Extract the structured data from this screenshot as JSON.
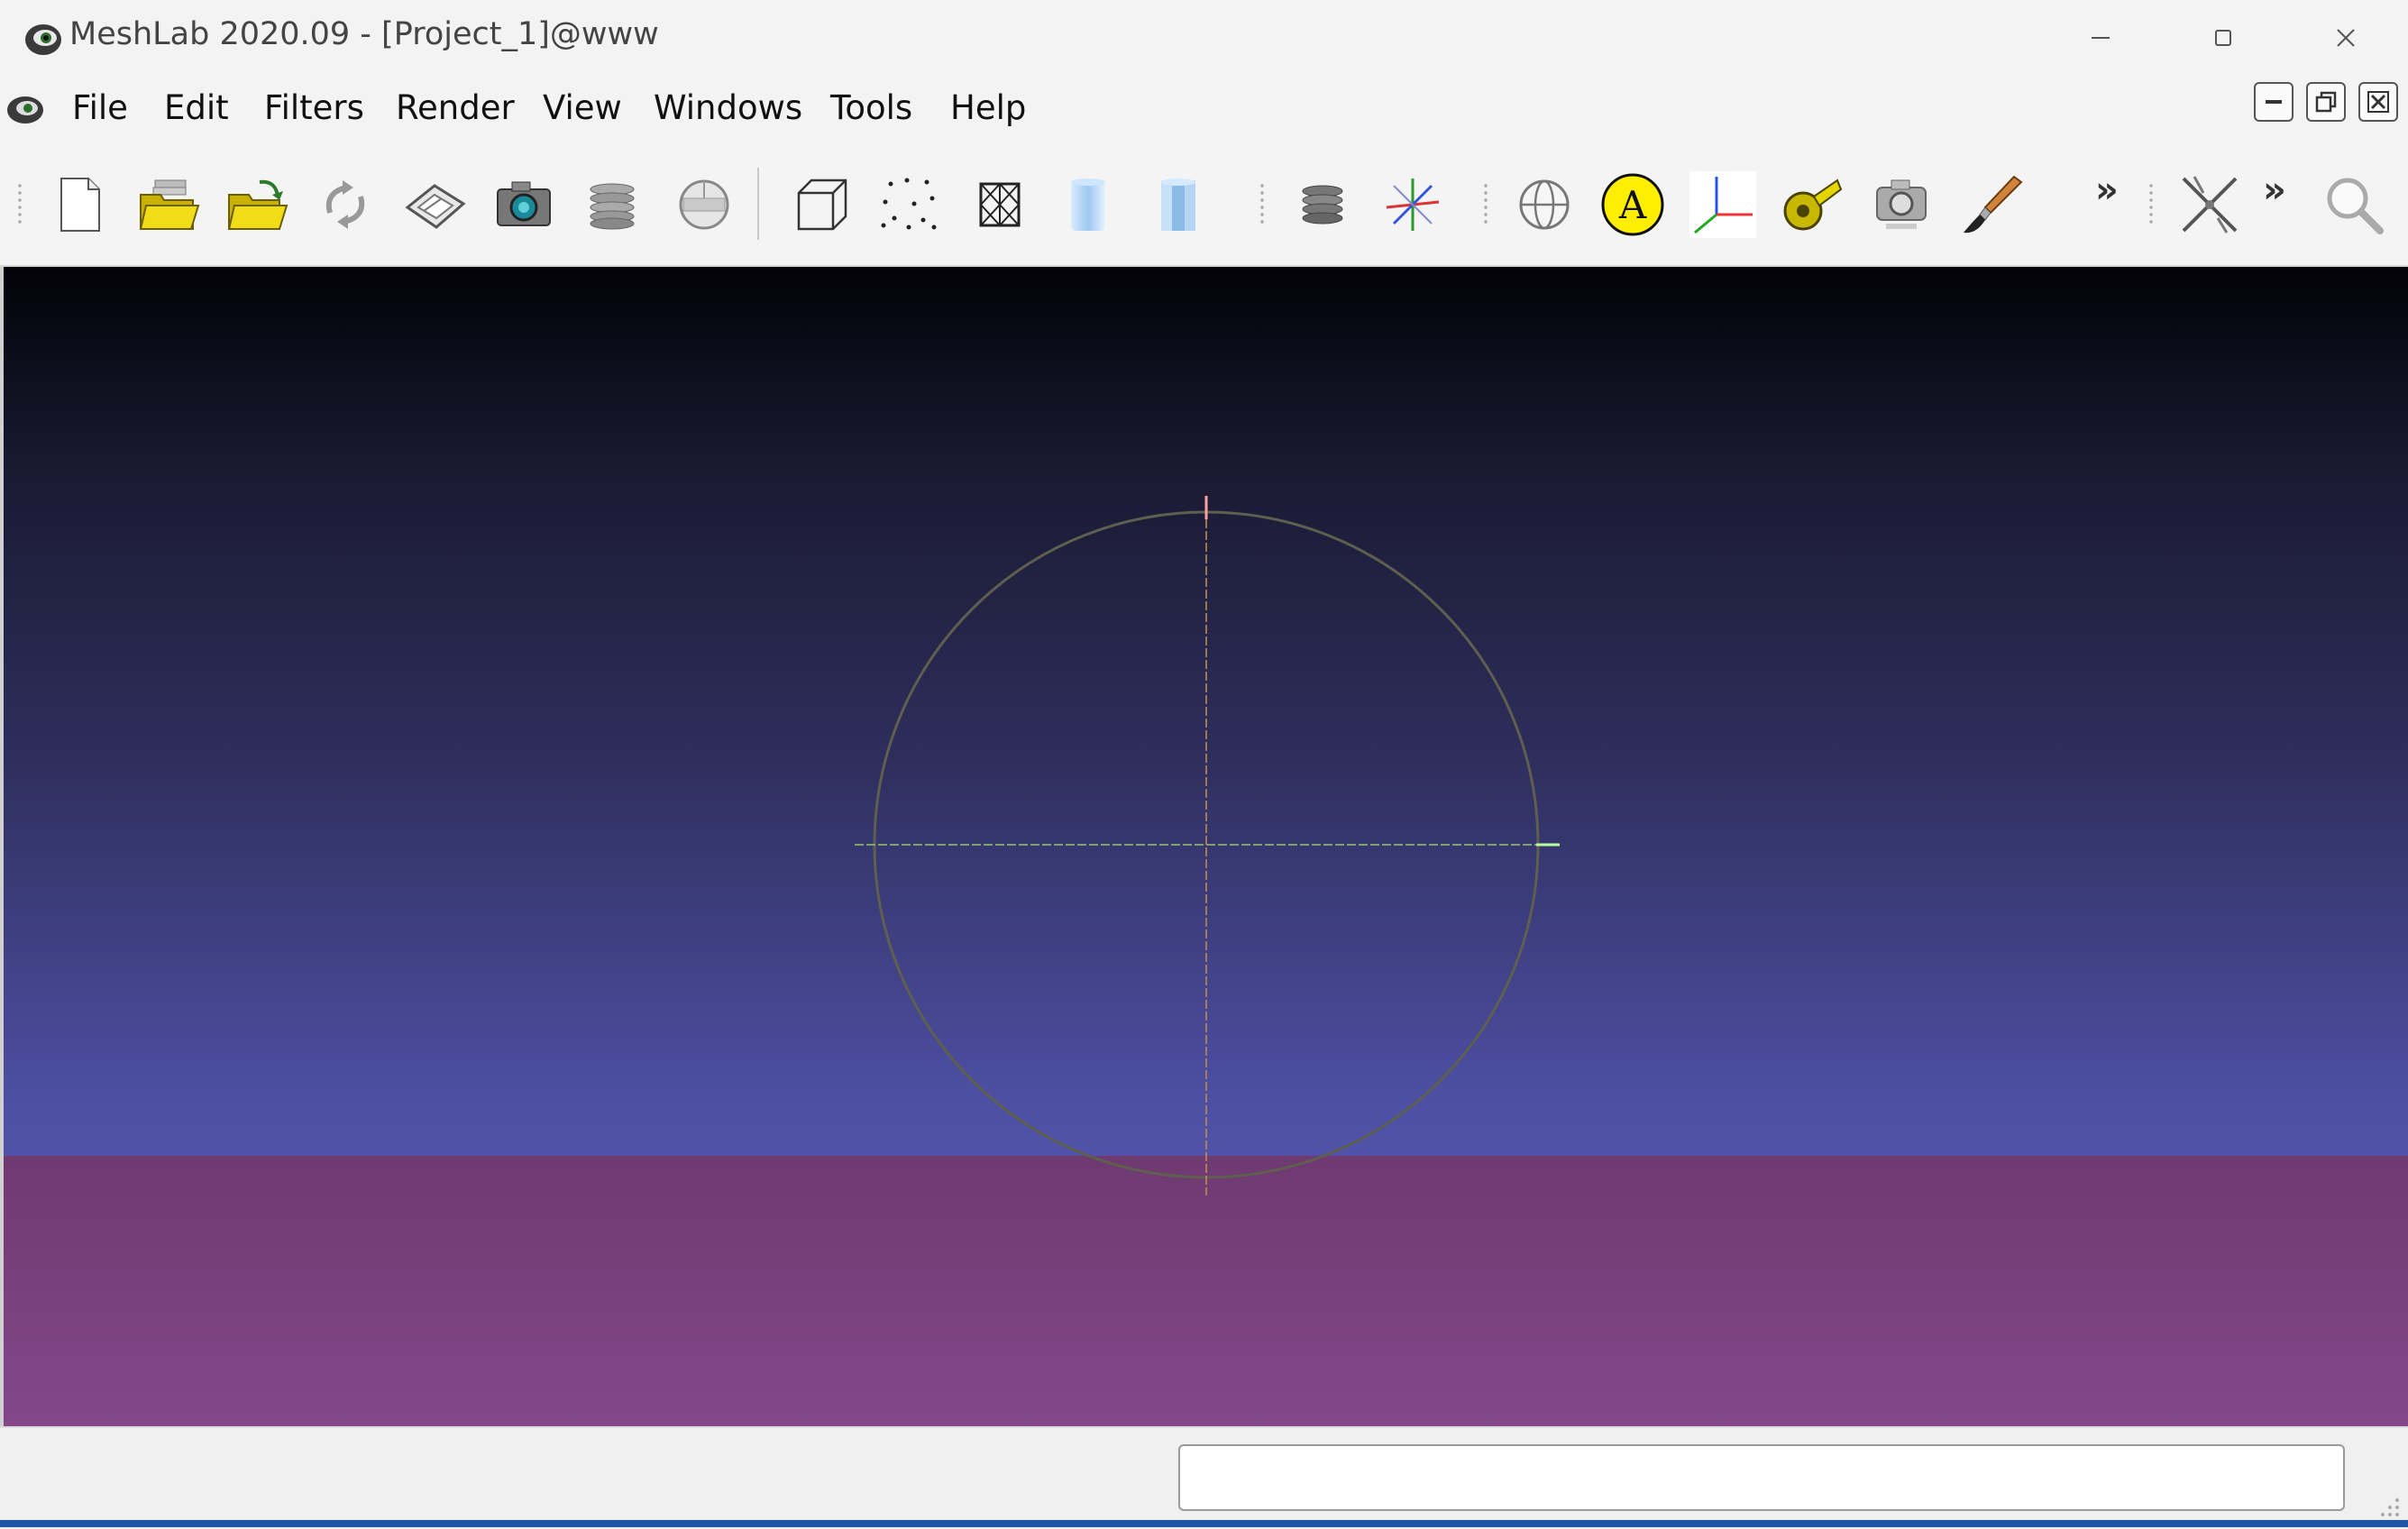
{
  "window": {
    "title": "MeshLab 2020.09 - [Project_1]@www"
  },
  "menubar": {
    "items": [
      {
        "label": "File"
      },
      {
        "label": "Edit"
      },
      {
        "label": "Filters"
      },
      {
        "label": "Render"
      },
      {
        "label": "View"
      },
      {
        "label": "Windows"
      },
      {
        "label": "Tools"
      },
      {
        "label": "Help"
      }
    ]
  },
  "toolbar": {
    "groups": [
      {
        "name": "file",
        "icons": [
          "new-project-icon",
          "open-project-icon",
          "import-mesh-icon",
          "reload-icon",
          "export-mesh-icon",
          "snapshot-icon",
          "layers-icon",
          "raster-icon"
        ]
      },
      {
        "name": "render-mode",
        "icons": [
          "bounding-box-icon",
          "points-icon",
          "wireframe-icon",
          "smooth-icon",
          "flat-icon"
        ]
      },
      {
        "name": "decorate",
        "icons": [
          "show-layers-icon",
          "show-axis-icon"
        ]
      },
      {
        "name": "edit",
        "icons": [
          "trackball-globe-icon",
          "annotation-icon",
          "align-axis-icon",
          "measure-tape-icon",
          "raster-alignment-icon",
          "paint-brush-icon",
          "select-vertices-icon",
          "zoom-icon"
        ]
      }
    ],
    "overflow_glyph": "»"
  },
  "colors": {
    "viewport_top": "#020207",
    "viewport_bottom": "#6365c7",
    "floor": "#7a4280",
    "trackball_ring": "#5f5f50",
    "axis_x": "#8fbf6a",
    "axis_y": "#c08a50",
    "annotation_yellow": "#ffee00"
  },
  "statusbar": {
    "text": ""
  }
}
